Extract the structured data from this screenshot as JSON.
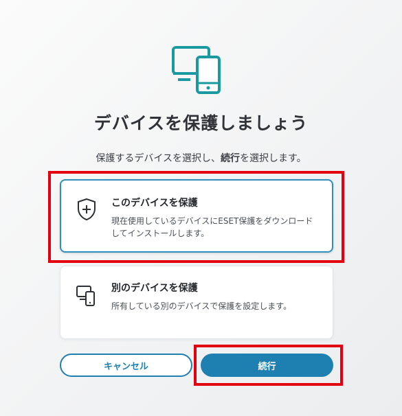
{
  "header": {
    "icon": "devices-icon",
    "title": "デバイスを保護しましょう",
    "subtitle_before": "保護するデバイスを選択し、",
    "subtitle_bold": "続行",
    "subtitle_after": "を選択します。"
  },
  "options": [
    {
      "icon": "shield-plus-icon",
      "title": "このデバイスを保護",
      "description": "現在使用しているデバイスにESET保護をダウンロードしてインストールします。",
      "selected": true
    },
    {
      "icon": "other-devices-icon",
      "title": "別のデバイスを保護",
      "description": "所有している別のデバイスで保護を設定します。",
      "selected": false
    }
  ],
  "buttons": {
    "cancel_label": "キャンセル",
    "continue_label": "続行"
  },
  "colors": {
    "accent": "#1e7fb1",
    "icon_teal": "#1a9aa0",
    "highlight_box": "#e3000f"
  }
}
